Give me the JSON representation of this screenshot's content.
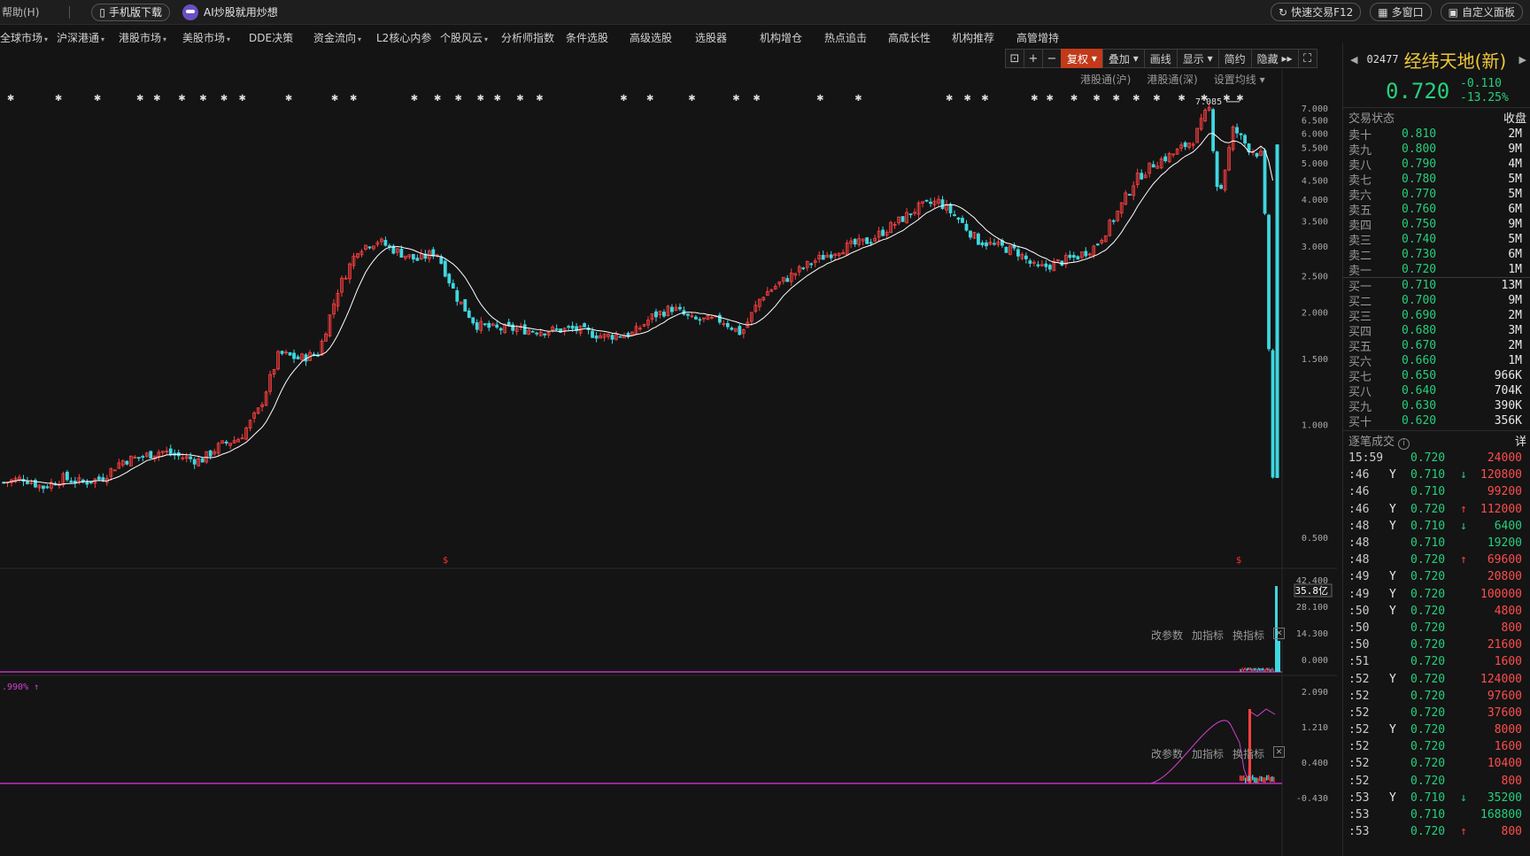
{
  "menubar": {
    "help": "帮助(H)",
    "mobile_download": "手机版下载",
    "ai_promo": "AI炒股就用炒想",
    "quick_trade": "快速交易F12",
    "multi_window": "多窗口",
    "custom_panel": "自定义面板"
  },
  "nav": [
    {
      "label": "全球市场",
      "dropdown": true
    },
    {
      "label": "沪深港通",
      "dropdown": true
    },
    {
      "label": "港股市场",
      "dropdown": true
    },
    {
      "label": "美股市场",
      "dropdown": true
    },
    {
      "label": "DDE决策",
      "dropdown": false
    },
    {
      "label": "资金流向",
      "dropdown": true
    },
    {
      "label": "L2核心内参",
      "dropdown": false
    },
    {
      "label": "个股风云",
      "dropdown": true
    },
    {
      "label": "分析师指数",
      "dropdown": false
    },
    {
      "label": "条件选股",
      "dropdown": false
    },
    {
      "label": "高级选股",
      "dropdown": false
    },
    {
      "label": "选股器",
      "dropdown": false
    },
    {
      "label": "机构增仓",
      "dropdown": false
    },
    {
      "label": "热点追击",
      "dropdown": false
    },
    {
      "label": "高成长性",
      "dropdown": false
    },
    {
      "label": "机构推荐",
      "dropdown": false
    },
    {
      "label": "高管增持",
      "dropdown": false
    }
  ],
  "toolbar": {
    "restore_rights": "复权",
    "overlay": "叠加",
    "draw_line": "画线",
    "display": "显示",
    "simple": "简约",
    "hide": "隐藏"
  },
  "chart_header": {
    "hk_connect_sh": "港股通(沪)",
    "hk_connect_sz": "港股通(深)",
    "ma_settings": "设置均线"
  },
  "panel_controls": {
    "change_params": "改参数",
    "add_indicator": "加指标",
    "switch_indicator": "换指标"
  },
  "chart_data": {
    "type": "candlestick",
    "y_scale": "log",
    "price_ticks": [
      "7.000",
      "6.500",
      "6.000",
      "5.500",
      "5.000",
      "4.500",
      "4.000",
      "3.500",
      "3.000",
      "2.500",
      "2.000",
      "1.500",
      "1.000",
      "0.500"
    ],
    "max_label": "7.085",
    "volume_ticks": [
      "42.400",
      "28.100",
      "14.300",
      "0.000"
    ],
    "volume_current": "35.8亿",
    "indicator_ticks": [
      "2.090",
      "1.210",
      "0.400",
      "-0.430"
    ],
    "indicator_label": ".990%",
    "trend_path": [
      [
        0,
        0.7
      ],
      [
        0.02,
        0.72
      ],
      [
        0.04,
        0.68
      ],
      [
        0.06,
        0.72
      ],
      [
        0.08,
        0.7
      ],
      [
        0.1,
        0.72
      ],
      [
        0.12,
        0.8
      ],
      [
        0.14,
        0.82
      ],
      [
        0.16,
        0.85
      ],
      [
        0.18,
        0.82
      ],
      [
        0.2,
        0.8
      ],
      [
        0.22,
        0.88
      ],
      [
        0.24,
        0.92
      ],
      [
        0.26,
        1.1
      ],
      [
        0.28,
        1.55
      ],
      [
        0.3,
        1.5
      ],
      [
        0.32,
        1.55
      ],
      [
        0.34,
        2.3
      ],
      [
        0.36,
        2.95
      ],
      [
        0.38,
        3.1
      ],
      [
        0.4,
        2.9
      ],
      [
        0.42,
        2.75
      ],
      [
        0.44,
        2.9
      ],
      [
        0.46,
        2.2
      ],
      [
        0.48,
        1.85
      ],
      [
        0.5,
        1.8
      ],
      [
        0.52,
        1.8
      ],
      [
        0.55,
        1.78
      ],
      [
        0.58,
        1.8
      ],
      [
        0.61,
        1.72
      ],
      [
        0.64,
        1.75
      ],
      [
        0.66,
        1.95
      ],
      [
        0.68,
        2.05
      ],
      [
        0.7,
        1.9
      ],
      [
        0.73,
        1.9
      ],
      [
        0.75,
        1.75
      ],
      [
        0.77,
        2.2
      ],
      [
        0.79,
        2.4
      ],
      [
        0.82,
        2.7
      ],
      [
        0.85,
        2.95
      ],
      [
        0.88,
        3.1
      ],
      [
        0.91,
        3.5
      ],
      [
        0.93,
        3.8
      ],
      [
        0.95,
        3.95
      ],
      [
        0.97,
        3.55
      ],
      [
        0.99,
        3.1
      ],
      [
        1.01,
        3.0
      ],
      [
        1.03,
        2.9
      ],
      [
        1.05,
        2.6
      ],
      [
        1.07,
        2.7
      ],
      [
        1.09,
        2.8
      ],
      [
        1.11,
        3.0
      ],
      [
        1.13,
        3.6
      ],
      [
        1.15,
        4.5
      ],
      [
        1.17,
        5.0
      ],
      [
        1.19,
        5.3
      ],
      [
        1.21,
        5.8
      ],
      [
        1.225,
        7.085
      ],
      [
        1.235,
        4.0
      ],
      [
        1.25,
        6.2
      ],
      [
        1.265,
        5.5
      ],
      [
        1.28,
        5.2
      ],
      [
        1.29,
        0.72
      ]
    ]
  },
  "stock": {
    "code": "02477",
    "name": "经纬天地(新)",
    "price": "0.720",
    "change": "-0.110",
    "change_pct": "-13.25%"
  },
  "trade_status": {
    "label": "交易状态",
    "value": "收盘"
  },
  "asks": [
    {
      "label": "卖十",
      "price": "0.810",
      "vol": "2M"
    },
    {
      "label": "卖九",
      "price": "0.800",
      "vol": "9M"
    },
    {
      "label": "卖八",
      "price": "0.790",
      "vol": "4M"
    },
    {
      "label": "卖七",
      "price": "0.780",
      "vol": "5M"
    },
    {
      "label": "卖六",
      "price": "0.770",
      "vol": "5M"
    },
    {
      "label": "卖五",
      "price": "0.760",
      "vol": "6M"
    },
    {
      "label": "卖四",
      "price": "0.750",
      "vol": "9M"
    },
    {
      "label": "卖三",
      "price": "0.740",
      "vol": "5M"
    },
    {
      "label": "卖二",
      "price": "0.730",
      "vol": "6M"
    },
    {
      "label": "卖一",
      "price": "0.720",
      "vol": "1M"
    }
  ],
  "bids": [
    {
      "label": "买一",
      "price": "0.710",
      "vol": "13M"
    },
    {
      "label": "买二",
      "price": "0.700",
      "vol": "9M"
    },
    {
      "label": "买三",
      "price": "0.690",
      "vol": "2M"
    },
    {
      "label": "买四",
      "price": "0.680",
      "vol": "3M"
    },
    {
      "label": "买五",
      "price": "0.670",
      "vol": "2M"
    },
    {
      "label": "买六",
      "price": "0.660",
      "vol": "1M"
    },
    {
      "label": "买七",
      "price": "0.650",
      "vol": "966K"
    },
    {
      "label": "买八",
      "price": "0.640",
      "vol": "704K"
    },
    {
      "label": "买九",
      "price": "0.630",
      "vol": "390K"
    },
    {
      "label": "买十",
      "price": "0.620",
      "vol": "356K"
    }
  ],
  "ticks_header": {
    "label": "逐笔成交",
    "detail": "详"
  },
  "ticks": [
    {
      "time": "15:59",
      "y": "",
      "price": "0.720",
      "dir": "",
      "vol": "24000",
      "side": "buy"
    },
    {
      "time": ":46",
      "y": "Y",
      "price": "0.710",
      "dir": "down",
      "vol": "120800",
      "side": "buy"
    },
    {
      "time": ":46",
      "y": "",
      "price": "0.710",
      "dir": "",
      "vol": "99200",
      "side": "buy"
    },
    {
      "time": ":46",
      "y": "Y",
      "price": "0.720",
      "dir": "up",
      "vol": "112000",
      "side": "buy"
    },
    {
      "time": ":48",
      "y": "Y",
      "price": "0.710",
      "dir": "down",
      "vol": "6400",
      "side": "sell"
    },
    {
      "time": ":48",
      "y": "",
      "price": "0.710",
      "dir": "",
      "vol": "19200",
      "side": "sell"
    },
    {
      "time": ":48",
      "y": "",
      "price": "0.720",
      "dir": "up",
      "vol": "69600",
      "side": "buy"
    },
    {
      "time": ":49",
      "y": "Y",
      "price": "0.720",
      "dir": "",
      "vol": "20800",
      "side": "buy"
    },
    {
      "time": ":49",
      "y": "Y",
      "price": "0.720",
      "dir": "",
      "vol": "100000",
      "side": "buy"
    },
    {
      "time": ":50",
      "y": "Y",
      "price": "0.720",
      "dir": "",
      "vol": "4800",
      "side": "buy"
    },
    {
      "time": ":50",
      "y": "",
      "price": "0.720",
      "dir": "",
      "vol": "800",
      "side": "buy"
    },
    {
      "time": ":50",
      "y": "",
      "price": "0.720",
      "dir": "",
      "vol": "21600",
      "side": "buy"
    },
    {
      "time": ":51",
      "y": "",
      "price": "0.720",
      "dir": "",
      "vol": "1600",
      "side": "buy"
    },
    {
      "time": ":52",
      "y": "Y",
      "price": "0.720",
      "dir": "",
      "vol": "124000",
      "side": "buy"
    },
    {
      "time": ":52",
      "y": "",
      "price": "0.720",
      "dir": "",
      "vol": "97600",
      "side": "buy"
    },
    {
      "time": ":52",
      "y": "",
      "price": "0.720",
      "dir": "",
      "vol": "37600",
      "side": "buy"
    },
    {
      "time": ":52",
      "y": "Y",
      "price": "0.720",
      "dir": "",
      "vol": "8000",
      "side": "buy"
    },
    {
      "time": ":52",
      "y": "",
      "price": "0.720",
      "dir": "",
      "vol": "1600",
      "side": "buy"
    },
    {
      "time": ":52",
      "y": "",
      "price": "0.720",
      "dir": "",
      "vol": "10400",
      "side": "buy"
    },
    {
      "time": ":52",
      "y": "",
      "price": "0.720",
      "dir": "",
      "vol": "800",
      "side": "buy"
    },
    {
      "time": ":53",
      "y": "Y",
      "price": "0.710",
      "dir": "down",
      "vol": "35200",
      "side": "sell"
    },
    {
      "time": ":53",
      "y": "",
      "price": "0.710",
      "dir": "",
      "vol": "168800",
      "side": "sell"
    },
    {
      "time": ":53",
      "y": "",
      "price": "0.720",
      "dir": "up",
      "vol": "800",
      "side": "buy"
    }
  ],
  "colors": {
    "up": "#ff4040",
    "down": "#26d07c",
    "accent": "#c23a1a",
    "name": "#f0c93a"
  }
}
